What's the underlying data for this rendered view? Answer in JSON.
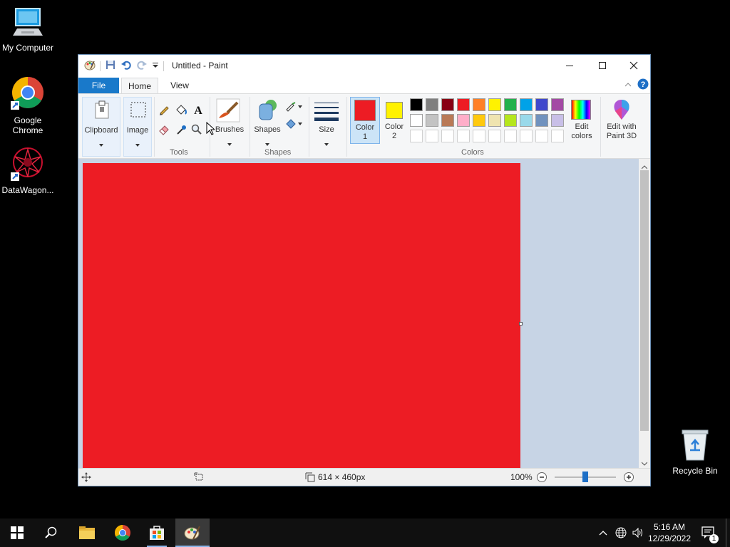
{
  "desktop": {
    "icons": [
      {
        "label": "My Computer"
      },
      {
        "label": "Google Chrome"
      },
      {
        "label": "DataWagon..."
      },
      {
        "label": "Recycle Bin"
      }
    ]
  },
  "window": {
    "title": "Untitled - Paint",
    "tabs": {
      "file": "File",
      "home": "Home",
      "view": "View"
    },
    "ribbon": {
      "clipboard": "Clipboard",
      "image": "Image",
      "tools_group": "Tools",
      "brushes": "Brushes",
      "shapes": "Shapes",
      "shapes_group": "Shapes",
      "size": "Size",
      "color1": "Color\n1",
      "color1_line1": "Color",
      "color1_line2": "1",
      "color2_line1": "Color",
      "color2_line2": "2",
      "edit_colors_line1": "Edit",
      "edit_colors_line2": "colors",
      "paint3d_line1": "Edit with",
      "paint3d_line2": "Paint 3D",
      "colors_group": "Colors"
    },
    "colors": {
      "color1": "#ed1c24",
      "color2": "#fff200",
      "palette_row1": [
        "#000000",
        "#7f7f7f",
        "#880015",
        "#ed1c24",
        "#ff7f27",
        "#fff200",
        "#22b14c",
        "#00a2e8",
        "#3f48cc",
        "#a349a4"
      ],
      "palette_row2": [
        "#ffffff",
        "#c3c3c3",
        "#b97a57",
        "#ffaec9",
        "#ffc90e",
        "#efe4b0",
        "#b5e61d",
        "#99d9ea",
        "#7092be",
        "#c8bfe7"
      ],
      "palette_row3": [
        "#ffffff",
        "#ffffff",
        "#ffffff",
        "#ffffff",
        "#ffffff",
        "#ffffff",
        "#ffffff",
        "#ffffff",
        "#ffffff",
        "#ffffff"
      ],
      "canvas_fill": "#ed1c24"
    },
    "status": {
      "dimensions": "614 × 460px",
      "zoom": "100%",
      "zoom_fraction": 0.5
    }
  },
  "taskbar": {
    "time": "5:16 AM",
    "date": "12/29/2022",
    "notifications_count": "1"
  }
}
